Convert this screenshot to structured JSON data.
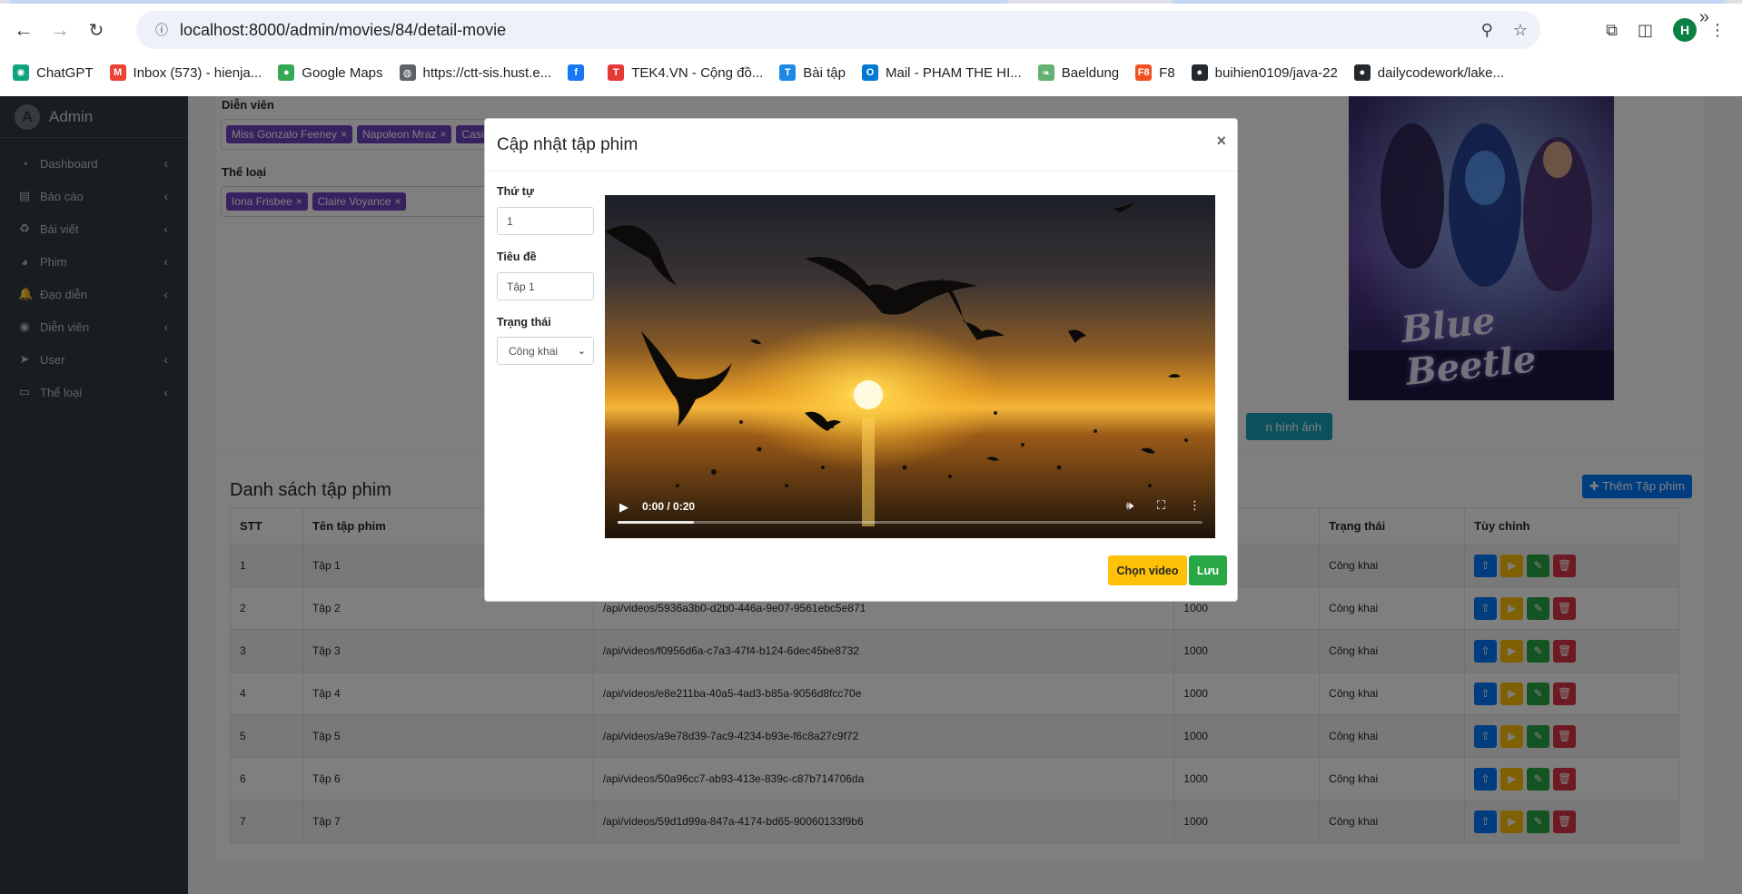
{
  "browser": {
    "url": "localhost:8000/admin/movies/84/detail-movie",
    "profile_initial": "H",
    "bookmarks": [
      {
        "label": "ChatGPT",
        "icon": "chatgpt-icon",
        "color": "#10a37f"
      },
      {
        "label": "Inbox (573) - hienja...",
        "icon": "gmail-icon",
        "color": "#ea4335"
      },
      {
        "label": "Google Maps",
        "icon": "maps-icon",
        "color": "#34a853"
      },
      {
        "label": "https://ctt-sis.hust.e...",
        "icon": "globe-icon",
        "color": "#5f6368"
      },
      {
        "label": "",
        "icon": "facebook-icon",
        "color": "#1877f2"
      },
      {
        "label": "TEK4.VN - Cộng đồ...",
        "icon": "tek4-icon",
        "color": "#e53935"
      },
      {
        "label": "Bài tập",
        "icon": "tasks-icon",
        "color": "#1e88e5"
      },
      {
        "label": "Mail - PHAM THE HI...",
        "icon": "outlook-icon",
        "color": "#0078d4"
      },
      {
        "label": "Baeldung",
        "icon": "baeldung-icon",
        "color": "#63b175"
      },
      {
        "label": "F8",
        "icon": "f8-icon",
        "color": "#f05123"
      },
      {
        "label": "buihien0109/java-22",
        "icon": "github-icon",
        "color": "#24292e"
      },
      {
        "label": "dailycodework/lake...",
        "icon": "github-icon",
        "color": "#24292e"
      }
    ]
  },
  "sidebar": {
    "brand": "Admin",
    "items": [
      {
        "label": "Dashboard",
        "icon": "dashboard-icon"
      },
      {
        "label": "Báo cáo",
        "icon": "report-icon"
      },
      {
        "label": "Bài viết",
        "icon": "blog-icon"
      },
      {
        "label": "Phim",
        "icon": "film-icon"
      },
      {
        "label": "Đạo diễn",
        "icon": "bell-icon"
      },
      {
        "label": "Diễn viên",
        "icon": "user-tie-icon"
      },
      {
        "label": "User",
        "icon": "send-icon"
      },
      {
        "label": "Thể loại",
        "icon": "folder-icon"
      }
    ]
  },
  "detail": {
    "actors_label": "Diễn viên",
    "actors": [
      "Miss Gonzalo Feeney",
      "Napoleon Mraz",
      "Casim"
    ],
    "genres_label": "Thể loại",
    "genres": [
      "Iona Frisbee",
      "Claire Voyance"
    ],
    "poster_title": "Blue Beetle",
    "image_button": "n hình ảnh"
  },
  "episodes": {
    "title": "Danh sách tập phim",
    "add_button": "Thêm Tập phim",
    "columns": [
      "STT",
      "Tên tập phim",
      "",
      "",
      "Trạng thái",
      "Tùy chỉnh"
    ],
    "rows": [
      {
        "stt": "1",
        "name": "Tập 1",
        "url": "",
        "duration": "",
        "status": "Công khai"
      },
      {
        "stt": "2",
        "name": "Tập 2",
        "url": "/api/videos/5936a3b0-d2b0-446a-9e07-9561ebc5e871",
        "duration": "1000",
        "status": "Công khai"
      },
      {
        "stt": "3",
        "name": "Tập 3",
        "url": "/api/videos/f0956d6a-c7a3-47f4-b124-6dec45be8732",
        "duration": "1000",
        "status": "Công khai"
      },
      {
        "stt": "4",
        "name": "Tập 4",
        "url": "/api/videos/e8e211ba-40a5-4ad3-b85a-9056d8fcc70e",
        "duration": "1000",
        "status": "Công khai"
      },
      {
        "stt": "5",
        "name": "Tập 5",
        "url": "/api/videos/a9e78d39-7ac9-4234-b93e-f6c8a27c9f72",
        "duration": "1000",
        "status": "Công khai"
      },
      {
        "stt": "6",
        "name": "Tập 6",
        "url": "/api/videos/50a96cc7-ab93-413e-839c-c87b714706da",
        "duration": "1000",
        "status": "Công khai"
      },
      {
        "stt": "7",
        "name": "Tập 7",
        "url": "/api/videos/59d1d99a-847a-4174-bd65-90060133f9b6",
        "duration": "1000",
        "status": "Công khai"
      }
    ]
  },
  "modal": {
    "title": "Cập nhật tập phim",
    "close": "×",
    "order_label": "Thứ tự",
    "order_value": "1",
    "title_label": "Tiêu đề",
    "title_value": "Tập 1",
    "status_label": "Trạng thái",
    "status_value": "Công khai",
    "video_time": "0:00 / 0:20",
    "video_progress": 0.13,
    "choose_video": "Chọn video",
    "save": "Lưu"
  }
}
